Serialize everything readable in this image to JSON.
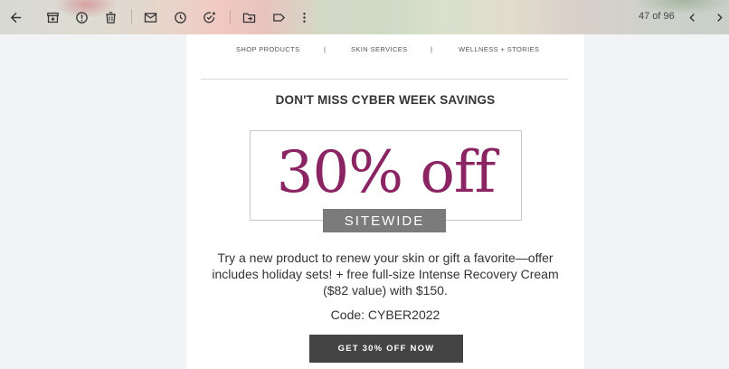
{
  "toolbar": {
    "icons": [
      "back-arrow-icon",
      "archive-icon",
      "report-spam-icon",
      "delete-icon",
      "mark-unread-icon",
      "snooze-icon",
      "add-task-icon",
      "move-to-icon",
      "label-icon",
      "more-icon"
    ],
    "pager": "47 of 96"
  },
  "email": {
    "nav": [
      "SHOP PRODUCTS",
      "|",
      "SKIN SERVICES",
      "|",
      "WELLNESS + STORIES"
    ],
    "headline": "DON'T MISS CYBER WEEK SAVINGS",
    "promo": "30% off",
    "promo_badge": "SITEWIDE",
    "body": "Try a new product to renew your skin or gift a favorite—offer includes holiday sets! + free full-size Intense Recovery Cream ($82 value) with $150.",
    "code": "Code: CYBER2022",
    "cta": "GET 30% OFF NOW",
    "colors": {
      "accent": "#8a2463",
      "badge": "#7b7b7b",
      "button": "#444444"
    }
  }
}
